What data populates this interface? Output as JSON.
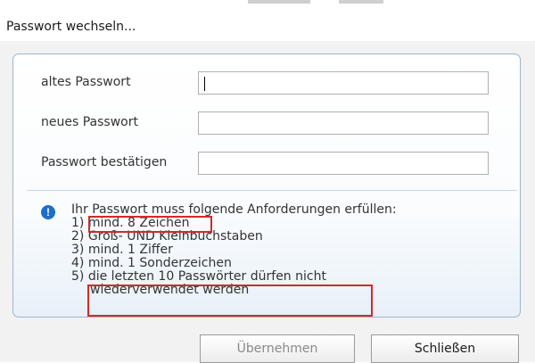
{
  "window": {
    "title": "Passwort wechseln..."
  },
  "form": {
    "old_password": {
      "label": "altes Passwort",
      "value": ""
    },
    "new_password": {
      "label": "neues Passwort",
      "value": ""
    },
    "confirm_password": {
      "label": "Passwort bestätigen",
      "value": ""
    }
  },
  "requirements": {
    "heading": "Ihr Passwort muss folgende Anforderungen erfüllen:",
    "items": [
      "1) mind. 8 Zeichen",
      "2) Groß- UND Kleinbuchstaben",
      "3) mind. 1 Ziffer",
      "4) mind. 1 Sonderzeichen",
      "5) die letzten 10 Passwörter dürfen nicht",
      "wiederverwendet werden"
    ]
  },
  "buttons": {
    "apply": "Übernehmen",
    "close": "Schließen"
  },
  "colors": {
    "highlight": "#d22a2a",
    "info_icon": "#1c6ec9",
    "panel_border": "#9db6cc"
  }
}
